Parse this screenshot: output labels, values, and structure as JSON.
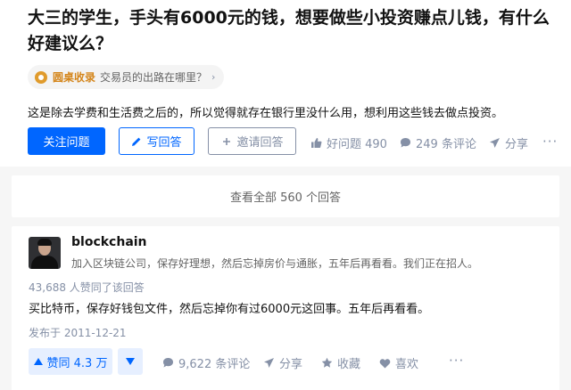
{
  "question": {
    "title": "大三的学生，手头有6000元的钱，想要做些小投资赚点儿钱，有什么好建议么？",
    "collection": {
      "icon": "roundtable-icon",
      "name": "圆桌收录",
      "text": "交易员的出路在哪里？"
    },
    "detail": "这是除去学费和生活费之后的，所以觉得就存在银行里没什么用，想利用这些钱去做点投资。",
    "buttons": {
      "follow": "关注问题",
      "write": "写回答",
      "invite": "邀请回答"
    },
    "actions": {
      "good_question": "好问题 490",
      "comments": "249 条评论",
      "share": "分享",
      "more": "···"
    }
  },
  "view_all": "查看全部 560 个回答",
  "answer": {
    "author": {
      "name": "blockchain",
      "bio": "加入区块链公司，保存好理想，然后忘掉房价与通胀，五年后再看看。我们正在招人。"
    },
    "vote_summary": "43,688 人赞同了该回答",
    "body": "买比特币，保存好钱包文件，然后忘掉你有过6000元这回事。五年后再看看。",
    "published": "发布于 2011-12-21",
    "actions": {
      "vote_up": "赞同 4.3 万",
      "comments": "9,622 条评论",
      "share": "分享",
      "favorite": "收藏",
      "like": "喜欢",
      "more": "···"
    }
  },
  "colors": {
    "brand_blue": "#0066ff",
    "muted": "#8590a6",
    "vote_bg": "#e6efff",
    "roundtable": "#d4851a"
  }
}
